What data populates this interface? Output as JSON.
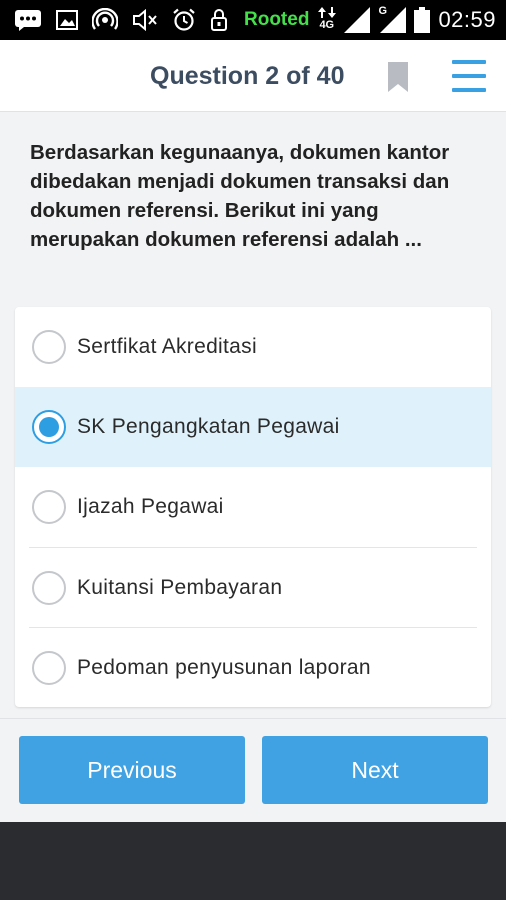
{
  "status_bar": {
    "rooted_label": "Rooted",
    "network_label": "4G",
    "sim_label": "G",
    "time": "02:59",
    "icons": [
      "message-icon",
      "image-icon",
      "hotspot-icon",
      "mute-icon",
      "alarm-icon",
      "lock-icon",
      "data-arrows-icon",
      "signal-icon",
      "signal-icon",
      "battery-icon"
    ]
  },
  "header": {
    "title": "Question 2 of 40"
  },
  "question": {
    "text": "Berdasarkan kegunaanya, dokumen kantor dibedakan menjadi dokumen transaksi dan dokumen referensi. Berikut ini yang merupakan dokumen referensi adalah ..."
  },
  "options": [
    {
      "label": "Sertfikat Akreditasi",
      "selected": false
    },
    {
      "label": "SK Pengangkatan Pegawai",
      "selected": true
    },
    {
      "label": "Ijazah Pegawai",
      "selected": false
    },
    {
      "label": "Kuitansi Pembayaran",
      "selected": false
    },
    {
      "label": "Pedoman penyusunan laporan",
      "selected": false
    }
  ],
  "footer": {
    "previous_label": "Previous",
    "next_label": "Next"
  },
  "colors": {
    "accent": "#40a2e3",
    "selected_bg": "#dff2fb",
    "title": "#3d4d61",
    "rooted": "#44e04a"
  }
}
